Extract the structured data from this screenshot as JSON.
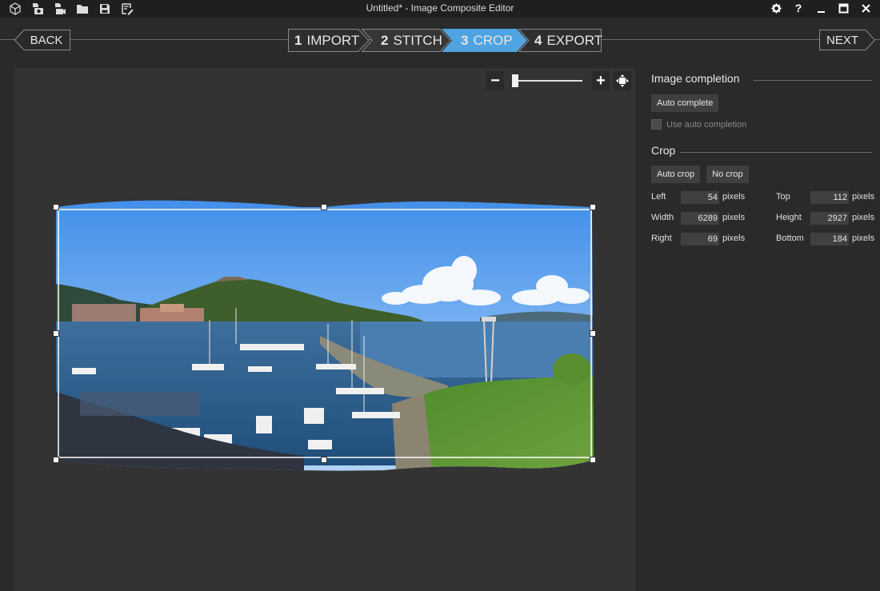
{
  "window": {
    "title": "Untitled* - Image Composite Editor",
    "toolbar_icons": [
      "new-project-icon",
      "camera-import-icon",
      "video-import-icon",
      "open-folder-icon",
      "save-icon",
      "export-edit-icon"
    ],
    "controls": [
      "settings-icon",
      "help-icon",
      "minimize-icon",
      "maximize-icon",
      "close-icon"
    ],
    "help_label": "?"
  },
  "nav": {
    "back_label": "BACK",
    "next_label": "NEXT",
    "steps": [
      {
        "num": "1",
        "label": "IMPORT",
        "active": false
      },
      {
        "num": "2",
        "label": "STITCH",
        "active": false
      },
      {
        "num": "3",
        "label": "CROP",
        "active": true
      },
      {
        "num": "4",
        "label": "EXPORT",
        "active": false
      }
    ],
    "active_color": "#4fa3e0"
  },
  "zoom": {
    "minus_label": "−",
    "plus_label": "+",
    "level": 0.05
  },
  "panel": {
    "image_completion": {
      "title": "Image completion",
      "auto_complete_label": "Auto complete",
      "use_auto_label": "Use auto completion"
    },
    "crop": {
      "title": "Crop",
      "auto_crop_label": "Auto crop",
      "no_crop_label": "No crop",
      "unit": "pixels",
      "left_label": "Left",
      "left_value": "54",
      "top_label": "Top",
      "top_value": "112",
      "width_label": "Width",
      "width_value": "6289",
      "height_label": "Height",
      "height_value": "2927",
      "right_label": "Right",
      "right_value": "69",
      "bottom_label": "Bottom",
      "bottom_value": "184"
    }
  }
}
